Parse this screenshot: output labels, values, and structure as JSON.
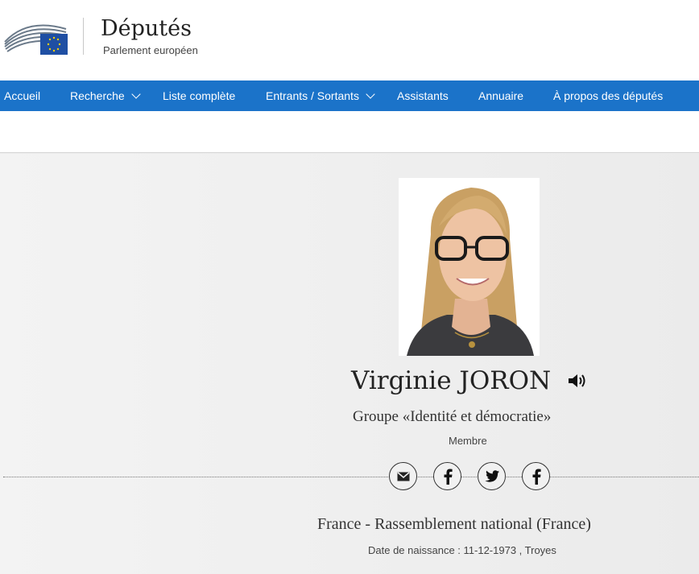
{
  "header": {
    "title": "Députés",
    "subtitle": "Parlement européen",
    "logo_icon": "european-parliament-logo-icon"
  },
  "nav": {
    "items": [
      {
        "label": "Accueil",
        "dropdown": false
      },
      {
        "label": "Recherche",
        "dropdown": true
      },
      {
        "label": "Liste complète",
        "dropdown": false
      },
      {
        "label": "Entrants / Sortants",
        "dropdown": true
      },
      {
        "label": "Assistants",
        "dropdown": false
      },
      {
        "label": "Annuaire",
        "dropdown": false
      },
      {
        "label": "À propos des députés",
        "dropdown": false
      }
    ],
    "color": "#1b73c9"
  },
  "profile": {
    "name": "Virginie JORON",
    "group": "Groupe «Identité et démocratie»",
    "role": "Membre",
    "country_party": "France - Rassemblement national (France)",
    "birth": "Date de naissance : 11-12-1973 , Troyes"
  },
  "social": [
    {
      "icon": "email-icon"
    },
    {
      "icon": "facebook-icon"
    },
    {
      "icon": "twitter-icon"
    },
    {
      "icon": "facebook-icon"
    }
  ]
}
